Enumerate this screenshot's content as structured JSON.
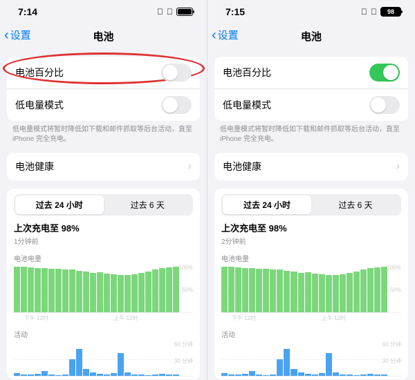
{
  "left": {
    "status": {
      "time": "7:14"
    },
    "nav": {
      "back": "设置",
      "title": "电池"
    },
    "rows": {
      "battery_percent": "电池百分比",
      "low_power": "低电量模式",
      "health": "电池健康"
    },
    "toggles": {
      "battery_percent_on": false,
      "low_power_on": false
    },
    "footnote": "低电量模式将暂时降低如下载和邮件抓取等后台活动，直至 iPhone 完全充电。",
    "tabs": {
      "t1": "过去 24 小时",
      "t2": "过去 6 天"
    },
    "charge": {
      "title": "上次充电至 98%",
      "sub": "1分钟前"
    },
    "battery_level_label": "电池电量",
    "activity_label": "活动",
    "y_labels": {
      "y100": "100%",
      "y50": "50%",
      "y0": "0"
    },
    "act_labels": {
      "a60": "60 分钟",
      "a30": "30 分钟",
      "a0": "0"
    },
    "xticks": [
      "下午 12时",
      "",
      "上午 12时",
      ""
    ]
  },
  "right": {
    "status": {
      "time": "7:15",
      "battery_pct": "98"
    },
    "nav": {
      "back": "设置",
      "title": "电池"
    },
    "rows": {
      "battery_percent": "电池百分比",
      "low_power": "低电量模式",
      "health": "电池健康"
    },
    "toggles": {
      "battery_percent_on": true,
      "low_power_on": false
    },
    "footnote": "低电量模式将暂时降低如下载和邮件抓取等后台活动，直至 iPhone 完全充电。",
    "tabs": {
      "t1": "过去 24 小时",
      "t2": "过去 6 天"
    },
    "charge": {
      "title": "上次充电至 98%",
      "sub": "2分钟前"
    },
    "battery_level_label": "电池电量",
    "activity_label": "活动",
    "y_labels": {
      "y100": "100%",
      "y50": "50%",
      "y0": "0"
    },
    "act_labels": {
      "a60": "60 分钟",
      "a30": "30 分钟",
      "a0": "0"
    },
    "xticks": [
      "下午 12时",
      "",
      "上午 12时",
      ""
    ]
  },
  "chart_data": [
    {
      "type": "bar",
      "title": "电池电量 (left)",
      "ylabel": "%",
      "ylim": [
        0,
        100
      ],
      "x_hours": 24,
      "values": [
        98,
        98,
        97,
        96,
        95,
        94,
        94,
        93,
        92,
        90,
        88,
        85,
        86,
        84,
        82,
        80,
        80,
        82,
        85,
        88,
        92,
        95,
        97,
        98
      ]
    },
    {
      "type": "bar",
      "title": "活动 (left)",
      "ylabel": "分钟",
      "ylim": [
        0,
        60
      ],
      "x_hours": 24,
      "values": [
        5,
        3,
        2,
        4,
        8,
        2,
        1,
        3,
        30,
        48,
        12,
        6,
        4,
        3,
        5,
        40,
        6,
        3,
        2,
        1,
        2,
        4,
        3,
        2
      ]
    },
    {
      "type": "bar",
      "title": "电池电量 (right)",
      "ylabel": "%",
      "ylim": [
        0,
        100
      ],
      "x_hours": 24,
      "values": [
        98,
        98,
        97,
        96,
        95,
        94,
        94,
        93,
        92,
        90,
        88,
        85,
        86,
        84,
        82,
        80,
        80,
        82,
        85,
        88,
        92,
        95,
        97,
        98
      ]
    },
    {
      "type": "bar",
      "title": "活动 (right)",
      "ylabel": "分钟",
      "ylim": [
        0,
        60
      ],
      "x_hours": 24,
      "values": [
        5,
        3,
        2,
        4,
        8,
        2,
        1,
        3,
        30,
        48,
        12,
        6,
        4,
        3,
        5,
        40,
        6,
        3,
        2,
        1,
        2,
        4,
        3,
        2
      ]
    }
  ]
}
